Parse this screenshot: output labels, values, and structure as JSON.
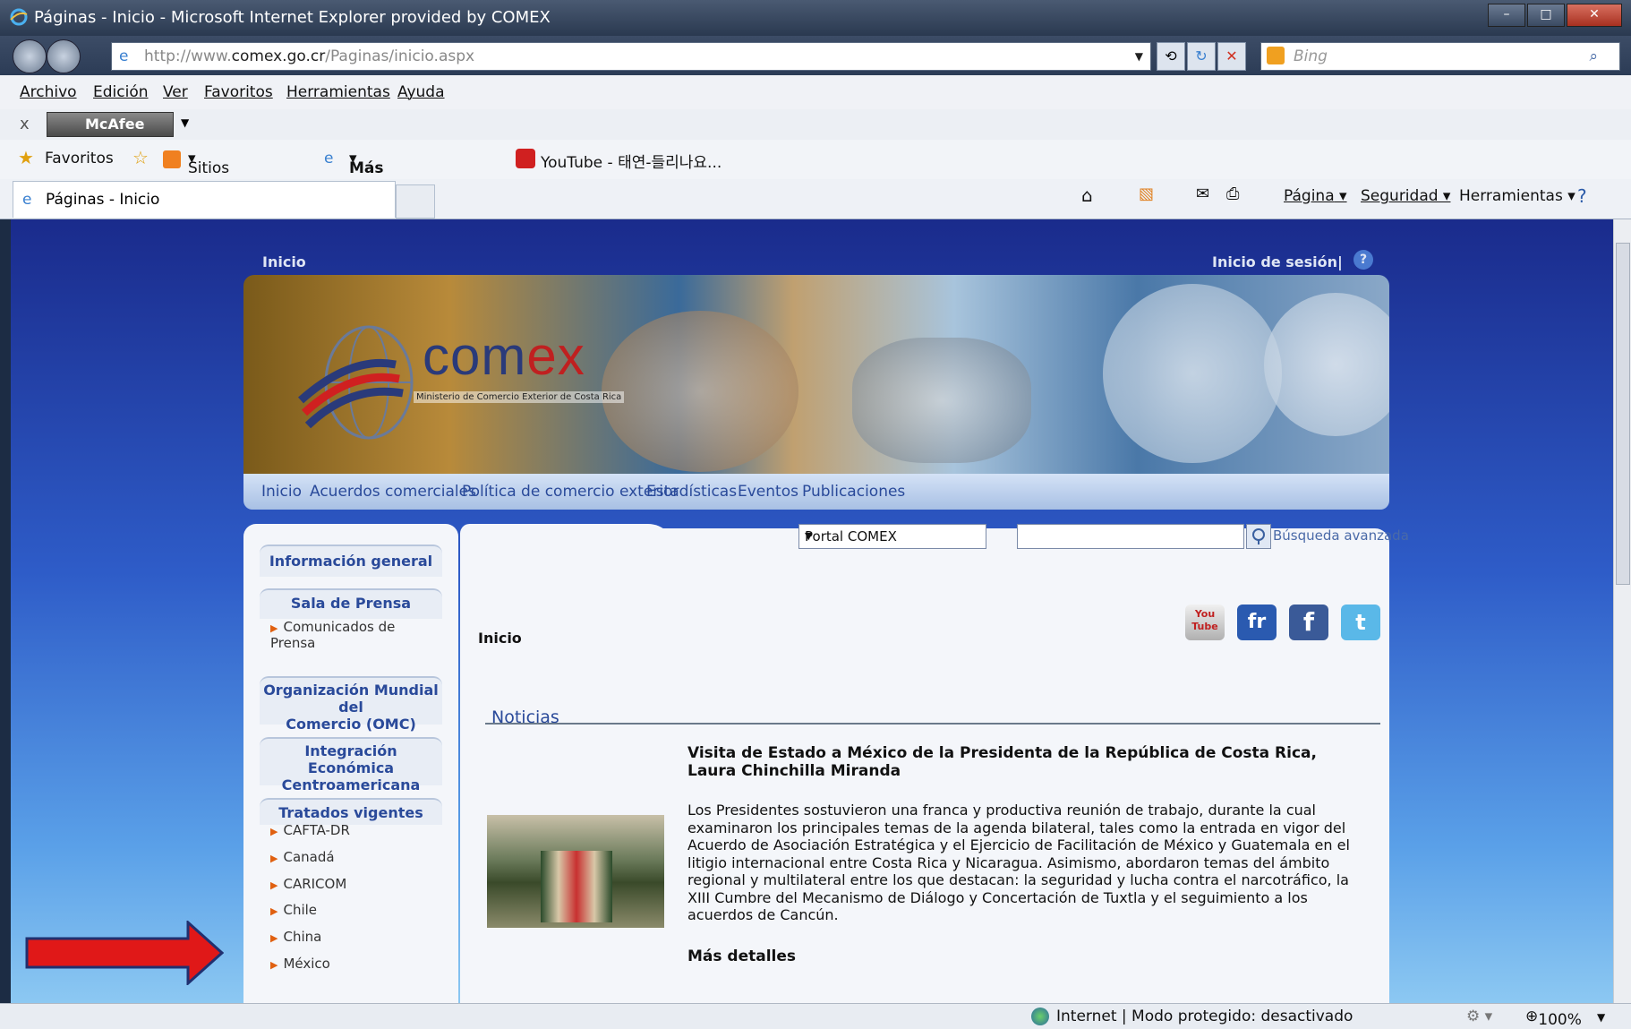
{
  "window": {
    "title": "Páginas - Inicio - Microsoft Internet Explorer provided by COMEX"
  },
  "address": {
    "url_prefix": "http://www.",
    "url_domain": "comex.go.cr",
    "url_path": "/Paginas/inicio.aspx"
  },
  "search": {
    "placeholder": "Bing"
  },
  "menu": {
    "archivo": "Archivo",
    "edicion": "Edición",
    "ver": "Ver",
    "favoritos": "Favoritos",
    "herramientas": "Herramientas",
    "ayuda": "Ayuda"
  },
  "toolbar": {
    "close": "x",
    "mcafee": "McAfee"
  },
  "favorites": {
    "label": "Favoritos",
    "suggested": "Sitios sugeridos",
    "addons": "Más complementos",
    "youtube": "YouTube - 태연-들리나요..."
  },
  "tab": {
    "label": "Páginas - Inicio"
  },
  "cmd": {
    "pagina": "Página",
    "seguridad": "Seguridad",
    "herramientas": "Herramientas"
  },
  "site": {
    "breadcrumb": "Inicio",
    "login": "Inicio de sesión|",
    "logo_word_a": "com",
    "logo_word_b": "ex",
    "logo_sub": "Ministerio de Comercio Exterior de Costa Rica",
    "nav": [
      "Inicio",
      "Acuerdos comerciales",
      "Política de comercio exterior",
      "Estadísticas",
      "Eventos",
      "Publicaciones"
    ],
    "portal_select": "Portal COMEX",
    "advanced_search": "Búsqueda avanzada",
    "sidebar": {
      "info": "Información general",
      "prensa": "Sala de Prensa",
      "comunicados_1": "Comunicados de",
      "comunicados_2": "Prensa",
      "omc_1": "Organización Mundial del",
      "omc_2": "Comercio (OMC)",
      "integ_1": "Integración Económica",
      "integ_2": "Centroamericana",
      "tratados": "Tratados vigentes",
      "treaties": [
        "CAFTA-DR",
        "Canadá",
        "CARICOM",
        "Chile",
        "China",
        "México"
      ]
    },
    "page_heading": "Inicio",
    "section": "Noticias",
    "social": [
      "You Tube",
      "fr",
      "f",
      "t"
    ],
    "news": {
      "title": "Visita de Estado a México de la Presidenta de la República de Costa Rica, Laura Chinchilla Miranda",
      "body": "Los Presidentes sostuvieron una franca y productiva reunión de trabajo, durante la cual examinaron los principales temas de la agenda bilateral, tales como la entrada en vigor del Acuerdo de Asociación Estratégica y el Ejercicio de Facilitación de México y Guatemala en el litigio internacional entre Costa Rica y Nicaragua. Asimismo, abordaron temas del ámbito regional y multilateral entre los que destacan: la seguridad y lucha contra el narcotráfico, la XIII Cumbre del Mecanismo de Diálogo y Concertación de Tuxtla y el seguimiento a los acuerdos de Cancún.",
      "more": "Más detalles"
    }
  },
  "status": {
    "zone": "Internet | Modo protegido: desactivado",
    "zoom": "100%"
  }
}
